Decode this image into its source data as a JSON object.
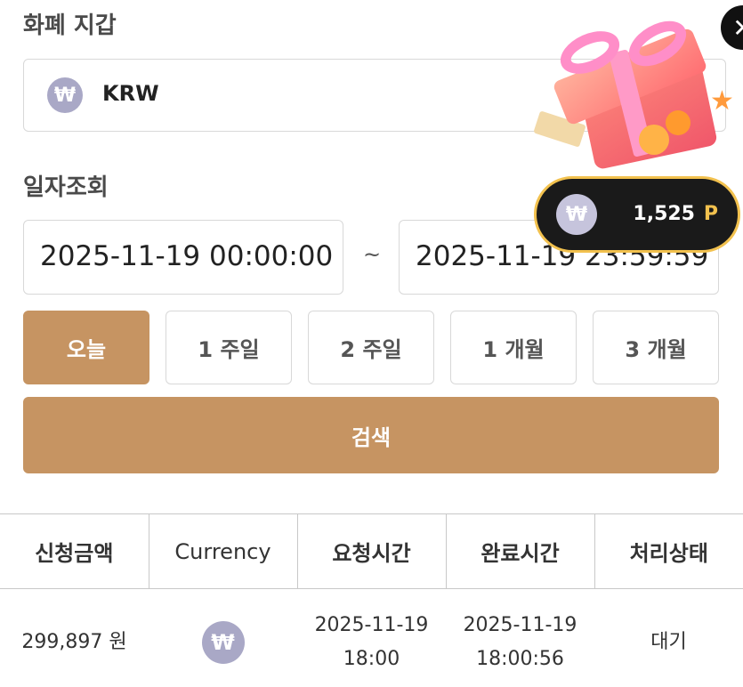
{
  "wallet": {
    "title": "화폐 지갑",
    "currency_symbol": "₩",
    "currency_code": "KRW"
  },
  "date_query": {
    "title": "일자조회",
    "start": "2025-11-19 00:00:00",
    "separator": "~",
    "end": "2025-11-19 23:59:59"
  },
  "periods": [
    {
      "label": "오늘",
      "active": true
    },
    {
      "label": "1 주일",
      "active": false
    },
    {
      "label": "2 주일",
      "active": false
    },
    {
      "label": "1 개월",
      "active": false
    },
    {
      "label": "3 개월",
      "active": false
    }
  ],
  "search": {
    "label": "검색"
  },
  "table": {
    "headers": [
      "신청금액",
      "Currency",
      "요청시간",
      "완료시간",
      "처리상태"
    ],
    "rows": [
      {
        "amount": "299,897 원",
        "currency_symbol": "₩",
        "request_date": "2025-11-19",
        "request_time": "18:00",
        "complete_date": "2025-11-19",
        "complete_time": "18:00:56",
        "status": "대기"
      }
    ]
  },
  "promo": {
    "close_symbol": "✕",
    "points_symbol": "₩",
    "points_value": "1,525",
    "points_unit": "P"
  },
  "colors": {
    "accent": "#c69462",
    "coin": "#a9a8c6",
    "pill_border": "#f2c14e",
    "pill_bg": "#1a1a1a"
  }
}
